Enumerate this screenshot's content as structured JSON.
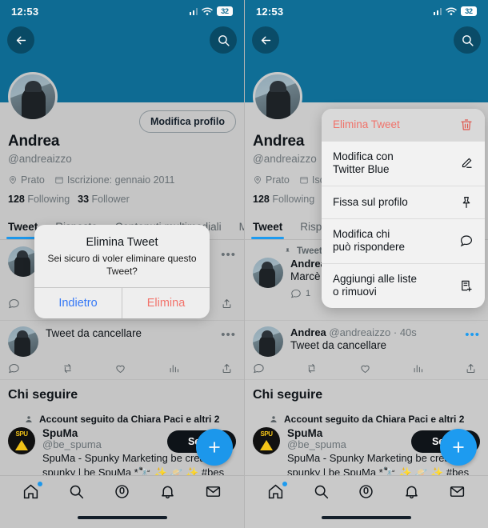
{
  "status_bar": {
    "time": "12:53",
    "battery": "32",
    "wifi_icon": "wifi-icon",
    "signal_icon": "cellular-signal-icon"
  },
  "nav": {
    "back_icon": "back-arrow-icon",
    "search_icon": "search-icon"
  },
  "profile": {
    "edit_button": "Modifica profilo",
    "name": "Andrea",
    "handle": "@andreaizzo",
    "location": "Prato",
    "joined": "Iscrizione: gennaio 2011",
    "following_count": "128",
    "following_label": "Following",
    "followers_count": "33",
    "followers_label": "Follower"
  },
  "tabs": [
    {
      "label": "Tweet",
      "active": true
    },
    {
      "label": "Risposte",
      "active": false
    },
    {
      "label": "Contenuti multimediali",
      "active": false
    },
    {
      "label": "M",
      "active": false
    }
  ],
  "tabs_right": [
    {
      "label": "Tweet",
      "active": true
    },
    {
      "label": "Risp",
      "active": false
    }
  ],
  "feed": {
    "pinned_label": "Tweet fissato",
    "pinned_tweet": {
      "name": "Andrea",
      "text": "Marcè in",
      "reply_count": "1"
    },
    "tweet": {
      "name": "Andrea",
      "handle": "@andreaizzo",
      "time": "40s",
      "text": "Tweet da cancellare",
      "more_icon": "more-options-icon"
    },
    "action_icons": [
      "reply-icon",
      "retweet-icon",
      "like-icon",
      "analytics-icon",
      "share-icon"
    ]
  },
  "who_to_follow": {
    "title": "Chi seguire",
    "context": "Account seguito da Chiara Paci e altri 2",
    "account": {
      "name": "SpuMa",
      "handle": "@be_spuma",
      "bio_line1": "SpuMa - Spunky Marketing be creati",
      "bio_line2": "spunky | be SpuMa *🔭 ✨ 🪐 ✨ #bes",
      "follow_button": "Segui"
    }
  },
  "alert": {
    "title": "Elimina Tweet",
    "message": "Sei sicuro di voler eliminare questo Tweet?",
    "cancel": "Indietro",
    "confirm": "Elimina",
    "cancel_color": "#3478f6",
    "confirm_color": "#f2736b"
  },
  "context_menu": [
    {
      "label": "Elimina Tweet",
      "icon": "trash-icon",
      "danger": true
    },
    {
      "label": "Modifica con\nTwitter Blue",
      "icon": "pencil-icon",
      "danger": false
    },
    {
      "label": "Fissa sul profilo",
      "icon": "pin-icon",
      "danger": false
    },
    {
      "label": "Modifica chi\npuò rispondere",
      "icon": "speech-bubble-icon",
      "danger": false
    },
    {
      "label": "Aggiungi alle liste\no rimuovi",
      "icon": "add-to-list-icon",
      "danger": false
    }
  ],
  "fab": {
    "icon": "plus-icon"
  },
  "bottom_nav": [
    {
      "icon": "home-icon",
      "badge": true
    },
    {
      "icon": "search-icon",
      "badge": false
    },
    {
      "icon": "spaces-icon",
      "badge": false
    },
    {
      "icon": "notifications-bell-icon",
      "badge": false
    },
    {
      "icon": "messages-envelope-icon",
      "badge": false
    }
  ],
  "colors": {
    "banner": "#0f6e96",
    "accent": "#1d9bf0",
    "danger": "#f0726a",
    "dark": "#0f1419"
  }
}
